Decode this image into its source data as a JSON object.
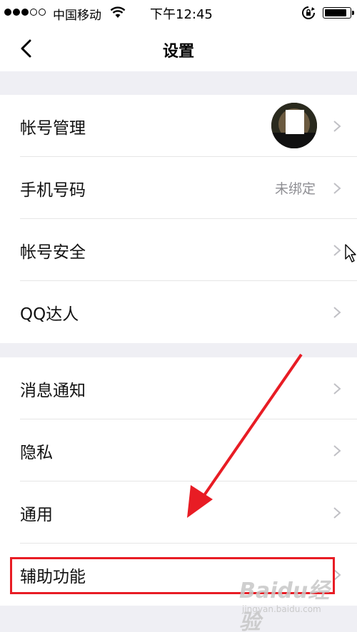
{
  "status_bar": {
    "carrier": "中国移动",
    "time": "下午12:45",
    "signal_bars_filled": 3,
    "signal_bars_total": 5,
    "battery_level": 0.9
  },
  "nav": {
    "title": "设置",
    "back_icon": "chevron-left-icon"
  },
  "groups": [
    {
      "items": [
        {
          "label": "帐号管理",
          "value": "",
          "has_avatar": true
        },
        {
          "label": "手机号码",
          "value": "未绑定"
        },
        {
          "label": "帐号安全",
          "value": ""
        },
        {
          "label": "QQ达人",
          "value": ""
        }
      ]
    },
    {
      "items": [
        {
          "label": "消息通知",
          "value": ""
        },
        {
          "label": "隐私",
          "value": ""
        },
        {
          "label": "通用",
          "value": ""
        },
        {
          "label": "辅助功能",
          "value": ""
        }
      ]
    }
  ],
  "annotation": {
    "color": "#e81c24",
    "highlighted_item": "辅助功能"
  },
  "watermark": {
    "logo": "Baidu经验",
    "url": "jingyan.baidu.com"
  }
}
